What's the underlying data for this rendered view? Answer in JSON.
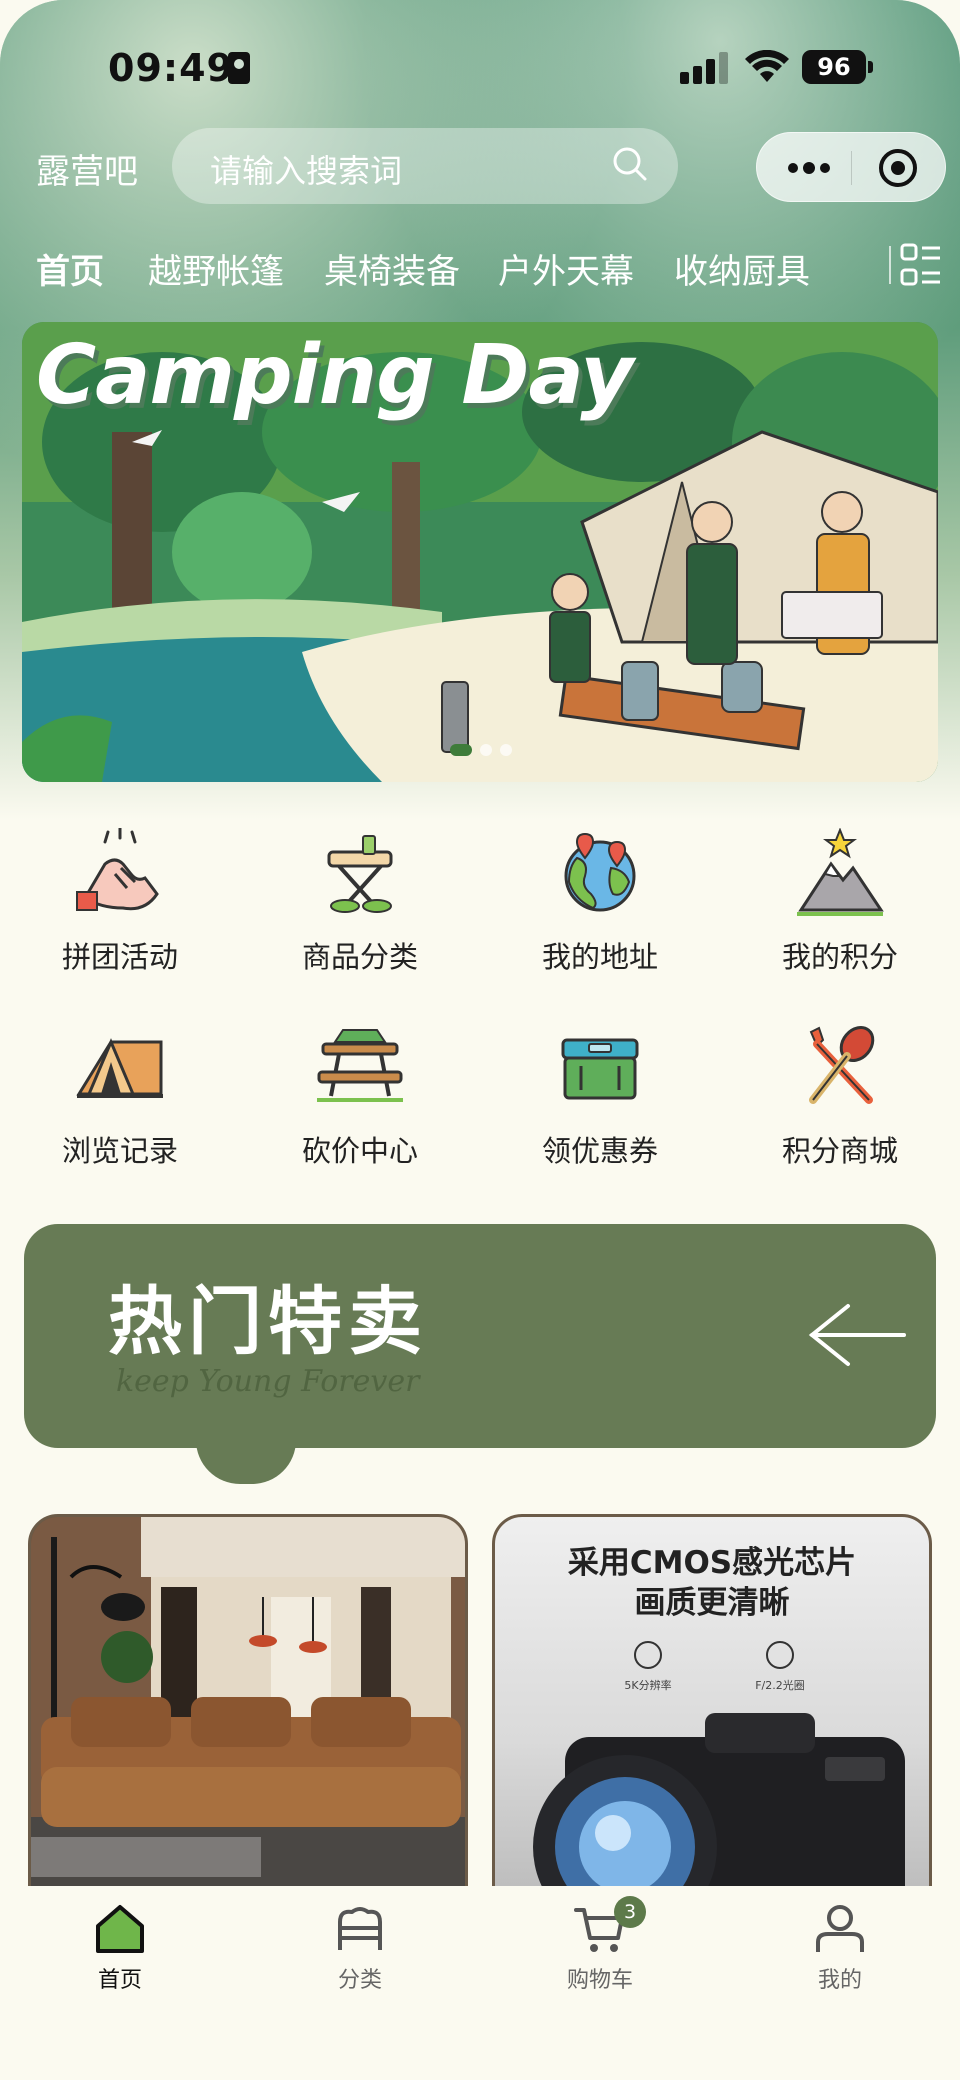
{
  "status_bar": {
    "time": "09:49",
    "battery": "96"
  },
  "top_bar": {
    "brand": "露营吧",
    "search_placeholder": "请输入搜索词"
  },
  "category_tabs": [
    "首页",
    "越野帐篷",
    "桌椅装备",
    "户外天幕",
    "收纳厨具"
  ],
  "banner": {
    "title": "Camping Day",
    "dots_total": 3,
    "dots_active": 0
  },
  "shortcuts": [
    {
      "label": "拼团活动",
      "icon": "handshake-icon"
    },
    {
      "label": "商品分类",
      "icon": "camp-table-icon"
    },
    {
      "label": "我的地址",
      "icon": "globe-pin-icon"
    },
    {
      "label": "我的积分",
      "icon": "mountain-star-icon"
    },
    {
      "label": "浏览记录",
      "icon": "tent-icon"
    },
    {
      "label": "砍价中心",
      "icon": "picnic-table-icon"
    },
    {
      "label": "领优惠券",
      "icon": "cooler-box-icon"
    },
    {
      "label": "积分商城",
      "icon": "utensils-icon"
    }
  ],
  "hot_section": {
    "title": "热门特卖",
    "subtitle": "keep Young Forever"
  },
  "products": [
    {
      "image": "living-room-sofa-photo"
    },
    {
      "title_line1": "采用CMOS感光芯片",
      "title_line2": "画质更清晰",
      "features": [
        "5K分辨率",
        "F/2.2光圈"
      ],
      "image": "camera-photo"
    }
  ],
  "tab_bar": [
    {
      "label": "首页",
      "icon": "home-icon",
      "active": true
    },
    {
      "label": "分类",
      "icon": "category-icon",
      "active": false
    },
    {
      "label": "购物车",
      "icon": "cart-icon",
      "active": false,
      "badge": "3"
    },
    {
      "label": "我的",
      "icon": "user-icon",
      "active": false
    }
  ],
  "colors": {
    "accent_green": "#677b55",
    "active_green": "#6fb64a",
    "background": "#fbfaf0"
  }
}
